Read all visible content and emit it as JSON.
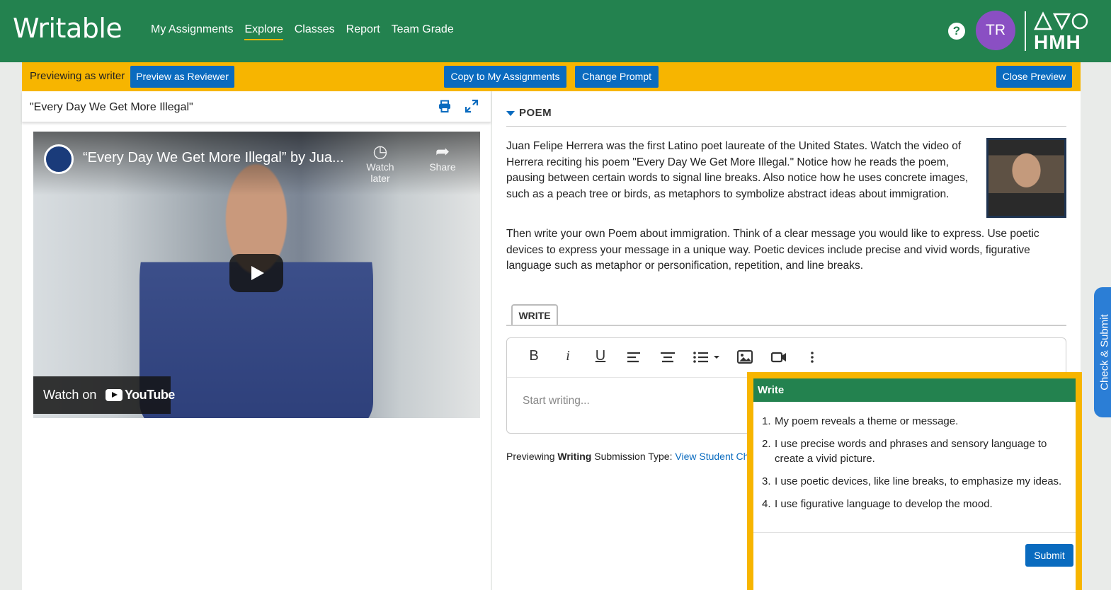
{
  "app": {
    "logo_text": "Writable"
  },
  "nav": {
    "items": [
      {
        "label": "My Assignments",
        "active": false
      },
      {
        "label": "Explore",
        "active": true
      },
      {
        "label": "Classes",
        "active": false
      },
      {
        "label": "Report",
        "active": false
      },
      {
        "label": "Team Grade",
        "active": false
      }
    ]
  },
  "header": {
    "help_icon": "question-circle",
    "avatar_initials": "TR",
    "brand": "HMH"
  },
  "preview_bar": {
    "label": "Previewing as writer",
    "preview_reviewer": "Preview as Reviewer",
    "copy": "Copy to My Assignments",
    "change_prompt": "Change Prompt",
    "close": "Close Preview"
  },
  "left": {
    "title": "\"Every Day We Get More Illegal\"",
    "print_icon": "printer",
    "expand_icon": "expand-arrows",
    "video": {
      "title": "“Every Day We Get More Illegal” by Jua...",
      "watch_later": "Watch later",
      "share": "Share",
      "watch_on": "Watch on",
      "youtube": "YouTube"
    }
  },
  "right": {
    "section_title": "POEM",
    "paragraph1": "Juan Felipe Herrera was the first Latino poet laureate of the United States. Watch the video of Herrera reciting his poem \"Every Day We Get More Illegal.\" Notice how he reads the poem, pausing between certain words to signal line breaks. Also notice how he uses concrete images, such as a peach tree or birds, as metaphors to symbolize abstract ideas about immigration.",
    "paragraph2": "Then write your own Poem about immigration. Think of a clear message you would like to express. Use poetic devices to express your message in a unique way. Poetic devices include precise and vivid words, figurative language such as metaphor or personification, repetition, and line breaks.",
    "tab_write": "WRITE",
    "toolbar": {
      "bold": "B",
      "italic": "i",
      "underline": "U"
    },
    "editor_placeholder": "Start writing...",
    "footer": {
      "previewing": "Previewing",
      "writing": "Writing",
      "submission_type": "Submission Type:",
      "link": "View Student Choi"
    }
  },
  "rubric": {
    "title": "Write",
    "items": [
      "My poem reveals a theme or message.",
      "I use precise words and phrases and sensory language to create a vivid picture.",
      "I use poetic devices, like line breaks, to emphasize my ideas.",
      "I use figurative language to develop the mood."
    ],
    "submit": "Submit"
  },
  "check_tab": "Check & Submit",
  "colors": {
    "brand_green": "#23824f",
    "accent_yellow": "#f7b500",
    "button_blue": "#0a6bbf",
    "avatar_purple": "#8a4fc3"
  }
}
